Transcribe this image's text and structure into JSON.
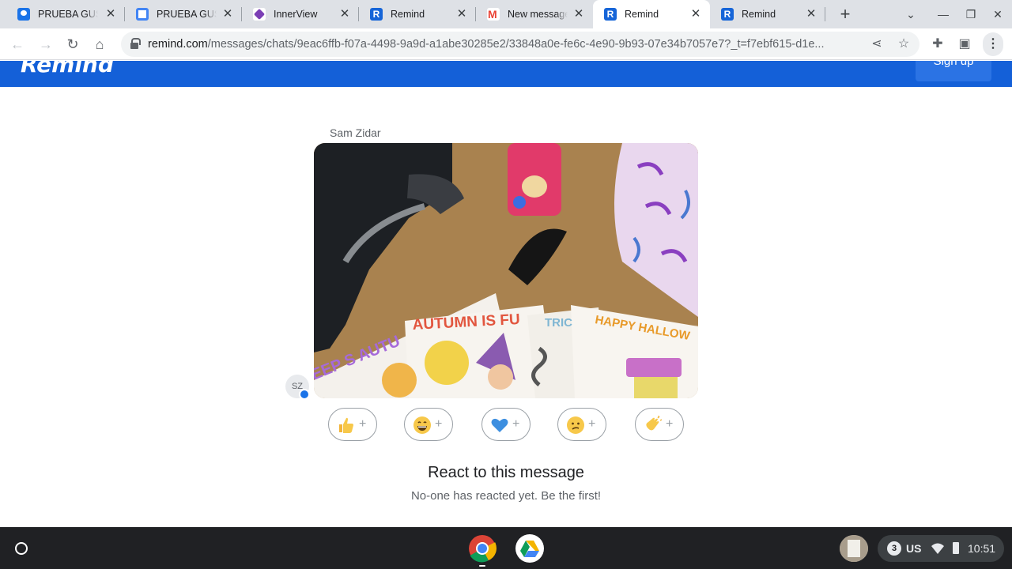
{
  "browser": {
    "tabs": [
      {
        "title": "PRUEBA GUSTAVO",
        "favicon": "google-forms-icon"
      },
      {
        "title": "PRUEBA GUSTAVO",
        "favicon": "checkmark-circle-icon"
      },
      {
        "title": "InnerView",
        "favicon": "innerview-icon"
      },
      {
        "title": "Remind",
        "favicon": "remind-icon"
      },
      {
        "title": "New message",
        "favicon": "gmail-icon"
      },
      {
        "title": "Remind",
        "favicon": "remind-icon",
        "active": true
      },
      {
        "title": "Remind",
        "favicon": "remind-icon"
      }
    ],
    "close_glyph": "✕",
    "new_tab_glyph": "+",
    "url_host": "remind.com",
    "url_path": "/messages/chats/9eac6ffb-f07a-4498-9a9d-a1abe30285e2/33848a0e-fe6c-4e90-9b93-07e34b7057e7?_t=f7ebf615-d1e..."
  },
  "site": {
    "logo": "Remind",
    "signup_label": "Sign up",
    "brand_color": "#1460d8"
  },
  "message": {
    "sender": "Sam Zidar",
    "avatar_initials": "SZ"
  },
  "reactions": [
    {
      "name": "thumbs-up",
      "plus": "+"
    },
    {
      "name": "grinning-face",
      "plus": "+"
    },
    {
      "name": "blue-heart",
      "plus": "+"
    },
    {
      "name": "confused-face",
      "plus": "+"
    },
    {
      "name": "clapping-hands",
      "plus": "+"
    }
  ],
  "react_title": "React to this message",
  "react_subtitle": "No-one has reacted yet. Be the first!",
  "system": {
    "notification_count": "3",
    "input_method": "US",
    "time": "10:51"
  }
}
